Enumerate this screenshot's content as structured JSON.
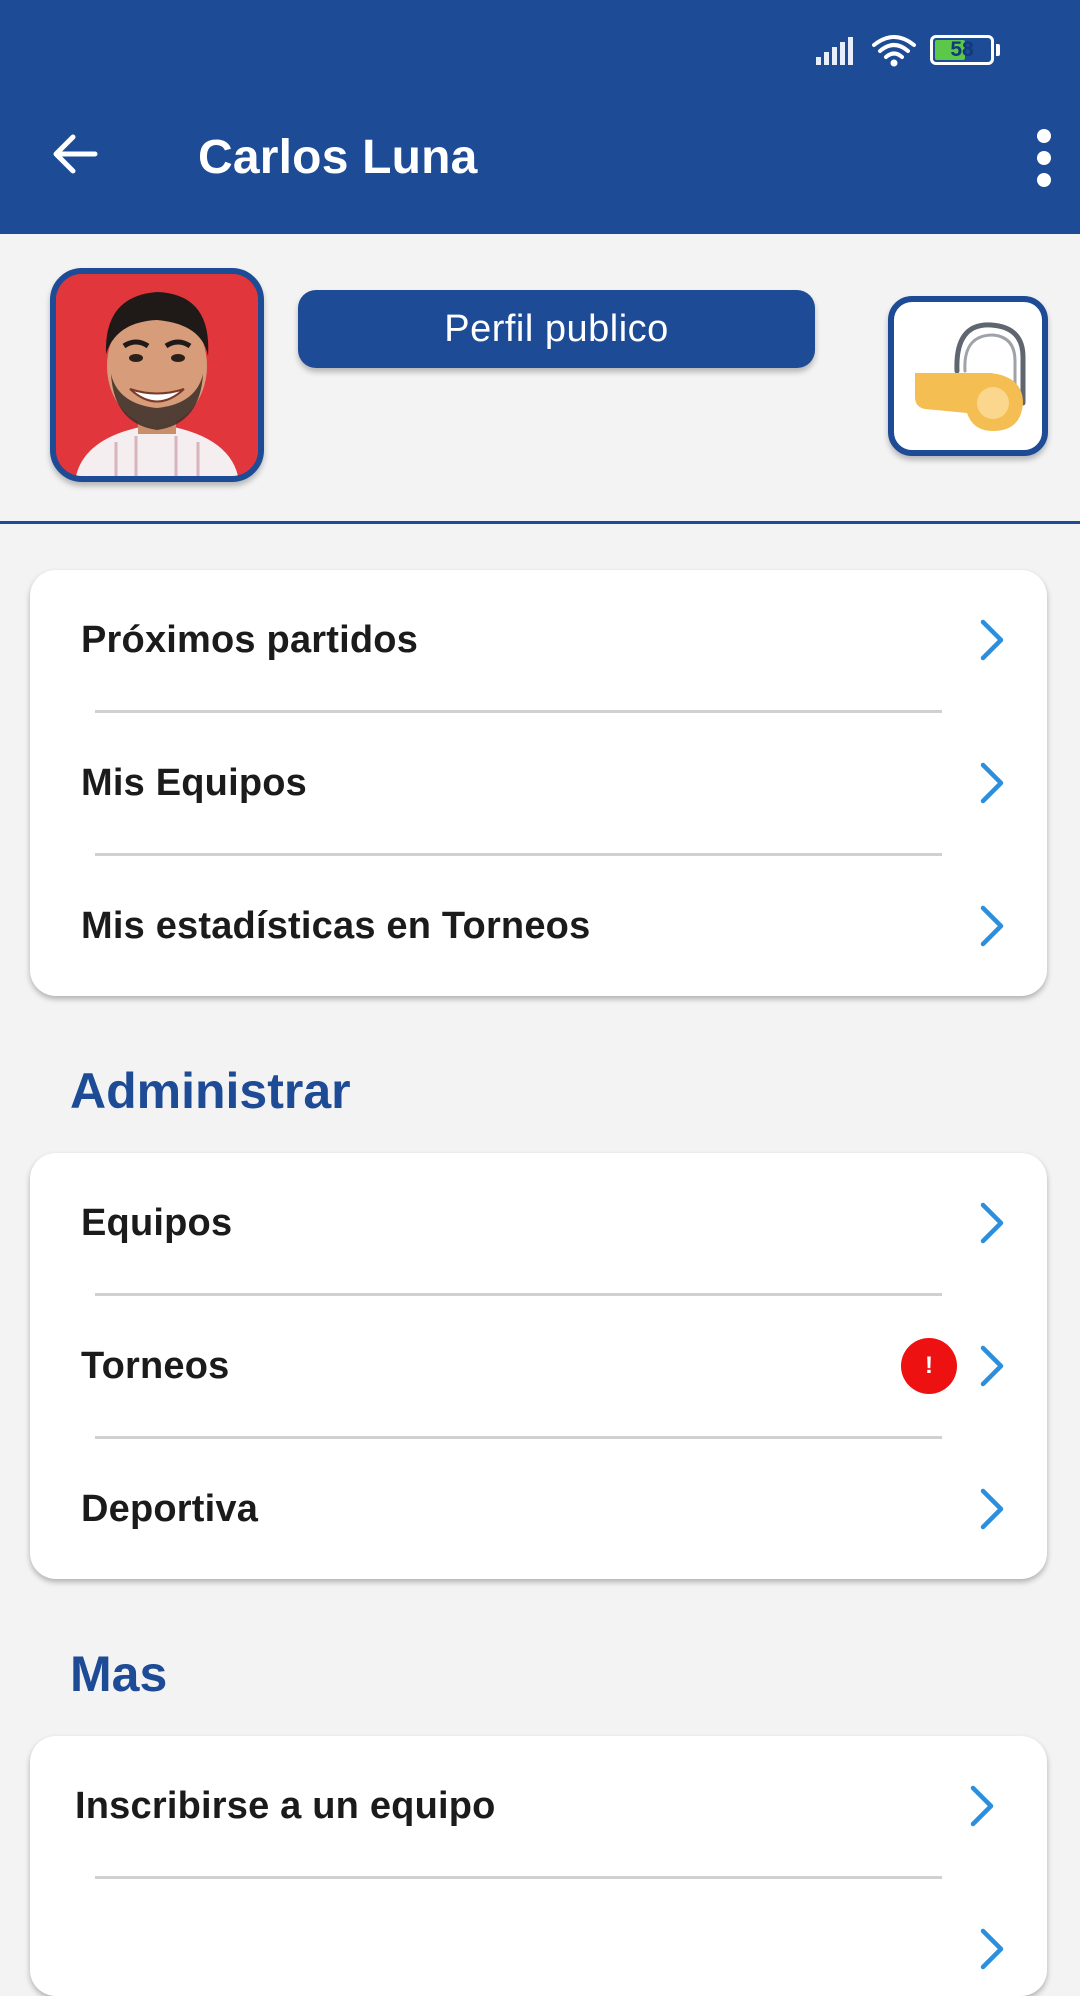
{
  "status_bar": {
    "battery_level": "58",
    "battery_fraction": 0.58
  },
  "header": {
    "title": "Carlos Luna",
    "back_icon": "arrow-left-icon",
    "more_icon": "more-vertical-icon"
  },
  "profile": {
    "public_profile_label": "Perfil publico",
    "role_icon": "whistle-icon"
  },
  "menu_main": [
    {
      "label": "Próximos partidos"
    },
    {
      "label": "Mis Equipos"
    },
    {
      "label": "Mis estadísticas en Torneos"
    }
  ],
  "admin": {
    "title": "Administrar",
    "items": [
      {
        "label": "Equipos"
      },
      {
        "label": "Torneos",
        "badge": "!"
      },
      {
        "label": "Deportiva"
      }
    ]
  },
  "more": {
    "title": "Mas",
    "items": [
      {
        "label": "Inscribirse a un equipo"
      },
      {
        "label": ""
      }
    ]
  },
  "colors": {
    "primary": "#1d4b96",
    "chevron": "#2b8fde",
    "alert": "#ee1111",
    "background": "#f3f3f3"
  }
}
